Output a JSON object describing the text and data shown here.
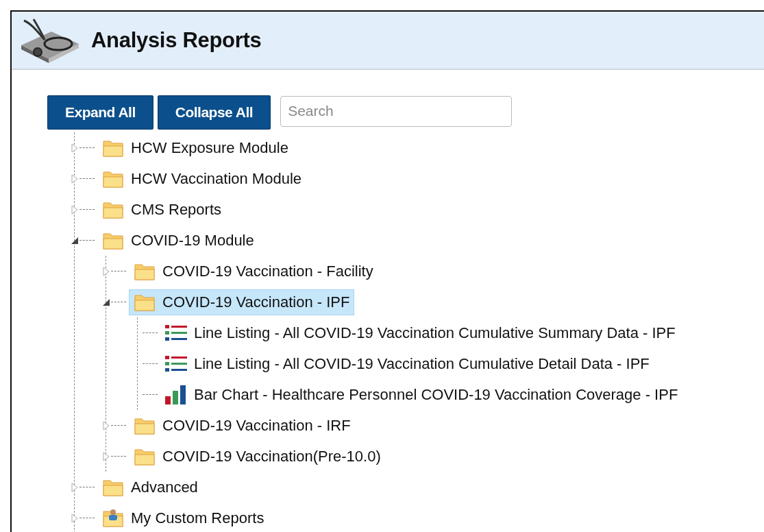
{
  "header": {
    "title": "Analysis Reports"
  },
  "toolbar": {
    "buttons": [
      "Expand All",
      "Collapse All"
    ],
    "search": {
      "placeholder": "Search"
    }
  },
  "tree": [
    {
      "kind": "folder",
      "label": "HCW Exposure Module",
      "expanded": false,
      "selected": false
    },
    {
      "kind": "folder",
      "label": "HCW Vaccination Module",
      "expanded": false,
      "selected": false
    },
    {
      "kind": "folder",
      "label": "CMS Reports",
      "expanded": false,
      "selected": false
    },
    {
      "kind": "folder",
      "label": "COVID-19 Module",
      "expanded": true,
      "selected": false,
      "children": [
        {
          "kind": "folder",
          "label": "COVID-19 Vaccination - Facility",
          "expanded": false,
          "selected": false
        },
        {
          "kind": "folder",
          "label": "COVID-19 Vaccination - IPF",
          "expanded": true,
          "selected": true,
          "children": [
            {
              "kind": "listing",
              "label": "Line Listing - All COVID-19 Vaccination Cumulative Summary Data - IPF",
              "selected": false
            },
            {
              "kind": "listing",
              "label": "Line Listing - All COVID-19 Vaccination Cumulative Detail Data - IPF",
              "selected": false
            },
            {
              "kind": "chart",
              "label": "Bar Chart - Healthcare Personnel COVID-19 Vaccination Coverage - IPF",
              "selected": false
            }
          ]
        },
        {
          "kind": "folder",
          "label": "COVID-19 Vaccination - IRF",
          "expanded": false,
          "selected": false
        },
        {
          "kind": "folder",
          "label": "COVID-19 Vaccination(Pre-10.0)",
          "expanded": false,
          "selected": false
        }
      ]
    },
    {
      "kind": "folder",
      "label": "Advanced",
      "expanded": false,
      "selected": false
    },
    {
      "kind": "custom",
      "label": "My Custom Reports",
      "expanded": false,
      "selected": false
    }
  ]
}
